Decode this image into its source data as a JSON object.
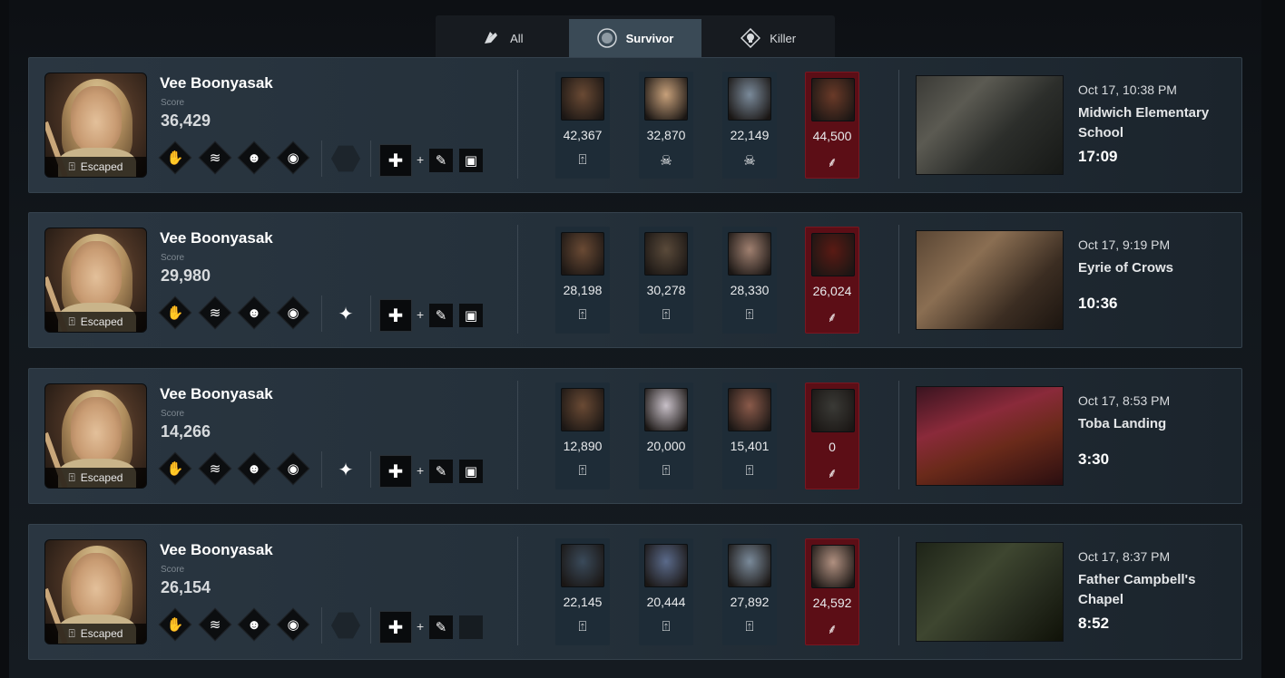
{
  "tabs": [
    {
      "label": "All",
      "icon": "all-icon"
    },
    {
      "label": "Survivor",
      "icon": "survivor-icon",
      "active": true
    },
    {
      "label": "Killer",
      "icon": "killer-icon"
    }
  ],
  "score_label": "Score",
  "colors": {
    "killer_card": "#5c0e16",
    "survivor_card": "#1e2c37",
    "active_tab": "#3a4a56"
  },
  "matches": [
    {
      "player": "Vee Boonyasak",
      "score": "36,429",
      "status": "Escaped",
      "offering": "empty",
      "addons": [
        "syringe",
        "tape"
      ],
      "players": [
        {
          "score": "42,367",
          "status": "escaped"
        },
        {
          "score": "32,870",
          "status": "dead"
        },
        {
          "score": "22,149",
          "status": "dead"
        },
        {
          "score": "44,500",
          "status": "killer",
          "killer": true
        }
      ],
      "date": "Oct 17, 10:38 PM",
      "map": "Midwich Elementary School",
      "duration": "17:09"
    },
    {
      "player": "Vee Boonyasak",
      "score": "29,980",
      "status": "Escaped",
      "offering": "offering",
      "addons": [
        "syringe",
        "tape"
      ],
      "players": [
        {
          "score": "28,198",
          "status": "escaped"
        },
        {
          "score": "30,278",
          "status": "escaped"
        },
        {
          "score": "28,330",
          "status": "escaped"
        },
        {
          "score": "26,024",
          "status": "killer",
          "killer": true
        }
      ],
      "date": "Oct 17, 9:19 PM",
      "map": "Eyrie of Crows",
      "duration": "10:36"
    },
    {
      "player": "Vee Boonyasak",
      "score": "14,266",
      "status": "Escaped",
      "offering": "offering",
      "addons": [
        "syringe",
        "tape"
      ],
      "players": [
        {
          "score": "12,890",
          "status": "escaped"
        },
        {
          "score": "20,000",
          "status": "escaped"
        },
        {
          "score": "15,401",
          "status": "escaped"
        },
        {
          "score": "0",
          "status": "killer",
          "killer": true
        }
      ],
      "date": "Oct 17, 8:53 PM",
      "map": "Toba Landing",
      "duration": "3:30"
    },
    {
      "player": "Vee Boonyasak",
      "score": "26,154",
      "status": "Escaped",
      "offering": "empty",
      "addons": [
        "syringe",
        "empty"
      ],
      "players": [
        {
          "score": "22,145",
          "status": "escaped"
        },
        {
          "score": "20,444",
          "status": "escaped"
        },
        {
          "score": "27,892",
          "status": "escaped"
        },
        {
          "score": "24,592",
          "status": "killer",
          "killer": true
        }
      ],
      "date": "Oct 17, 8:37 PM",
      "map": "Father Campbell's Chapel",
      "duration": "8:52"
    }
  ]
}
